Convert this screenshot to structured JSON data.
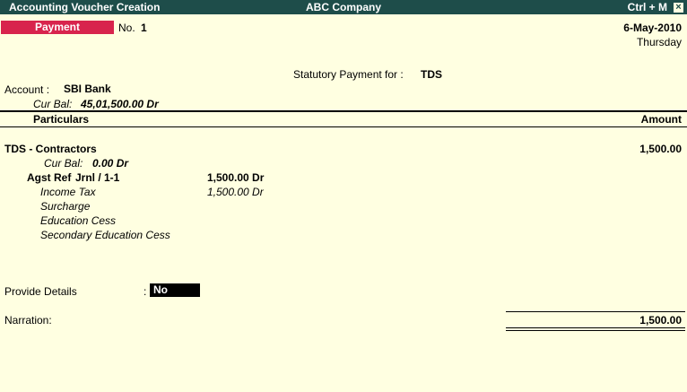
{
  "titlebar": {
    "left": "Accounting Voucher  Creation",
    "center": "ABC Company",
    "right": "Ctrl + M",
    "close_icon": "close-icon"
  },
  "voucher": {
    "type": "Payment",
    "no_label": "No.",
    "no_value": "1",
    "date": "6-May-2010",
    "day": "Thursday",
    "statutory_label": "Statutory Payment for :",
    "statutory_value": "TDS"
  },
  "account": {
    "label": "Account :",
    "value": "SBI Bank",
    "curbal_label": "Cur Bal:",
    "curbal_value": "45,01,500.00 Dr"
  },
  "table": {
    "col_particulars": "Particulars",
    "col_amount": "Amount",
    "rows": [
      {
        "ledger": "TDS - Contractors",
        "amount": "1,500.00",
        "curbal_label": "Cur Bal:",
        "curbal_value": "0.00 Dr",
        "ref_label": "Agst Ref",
        "ref_name": "Jrnl / 1-1",
        "ref_amount": "1,500.00 Dr",
        "duty_heads": [
          {
            "name": "Income Tax",
            "amount": "1,500.00 Dr"
          },
          {
            "name": "Surcharge",
            "amount": ""
          },
          {
            "name": "Education Cess",
            "amount": ""
          },
          {
            "name": "Secondary Education Cess",
            "amount": ""
          }
        ]
      }
    ]
  },
  "provide_details": {
    "label": "Provide Details",
    "colon": ":",
    "value": "No"
  },
  "narration": {
    "label": "Narration:",
    "total": "1,500.00"
  }
}
